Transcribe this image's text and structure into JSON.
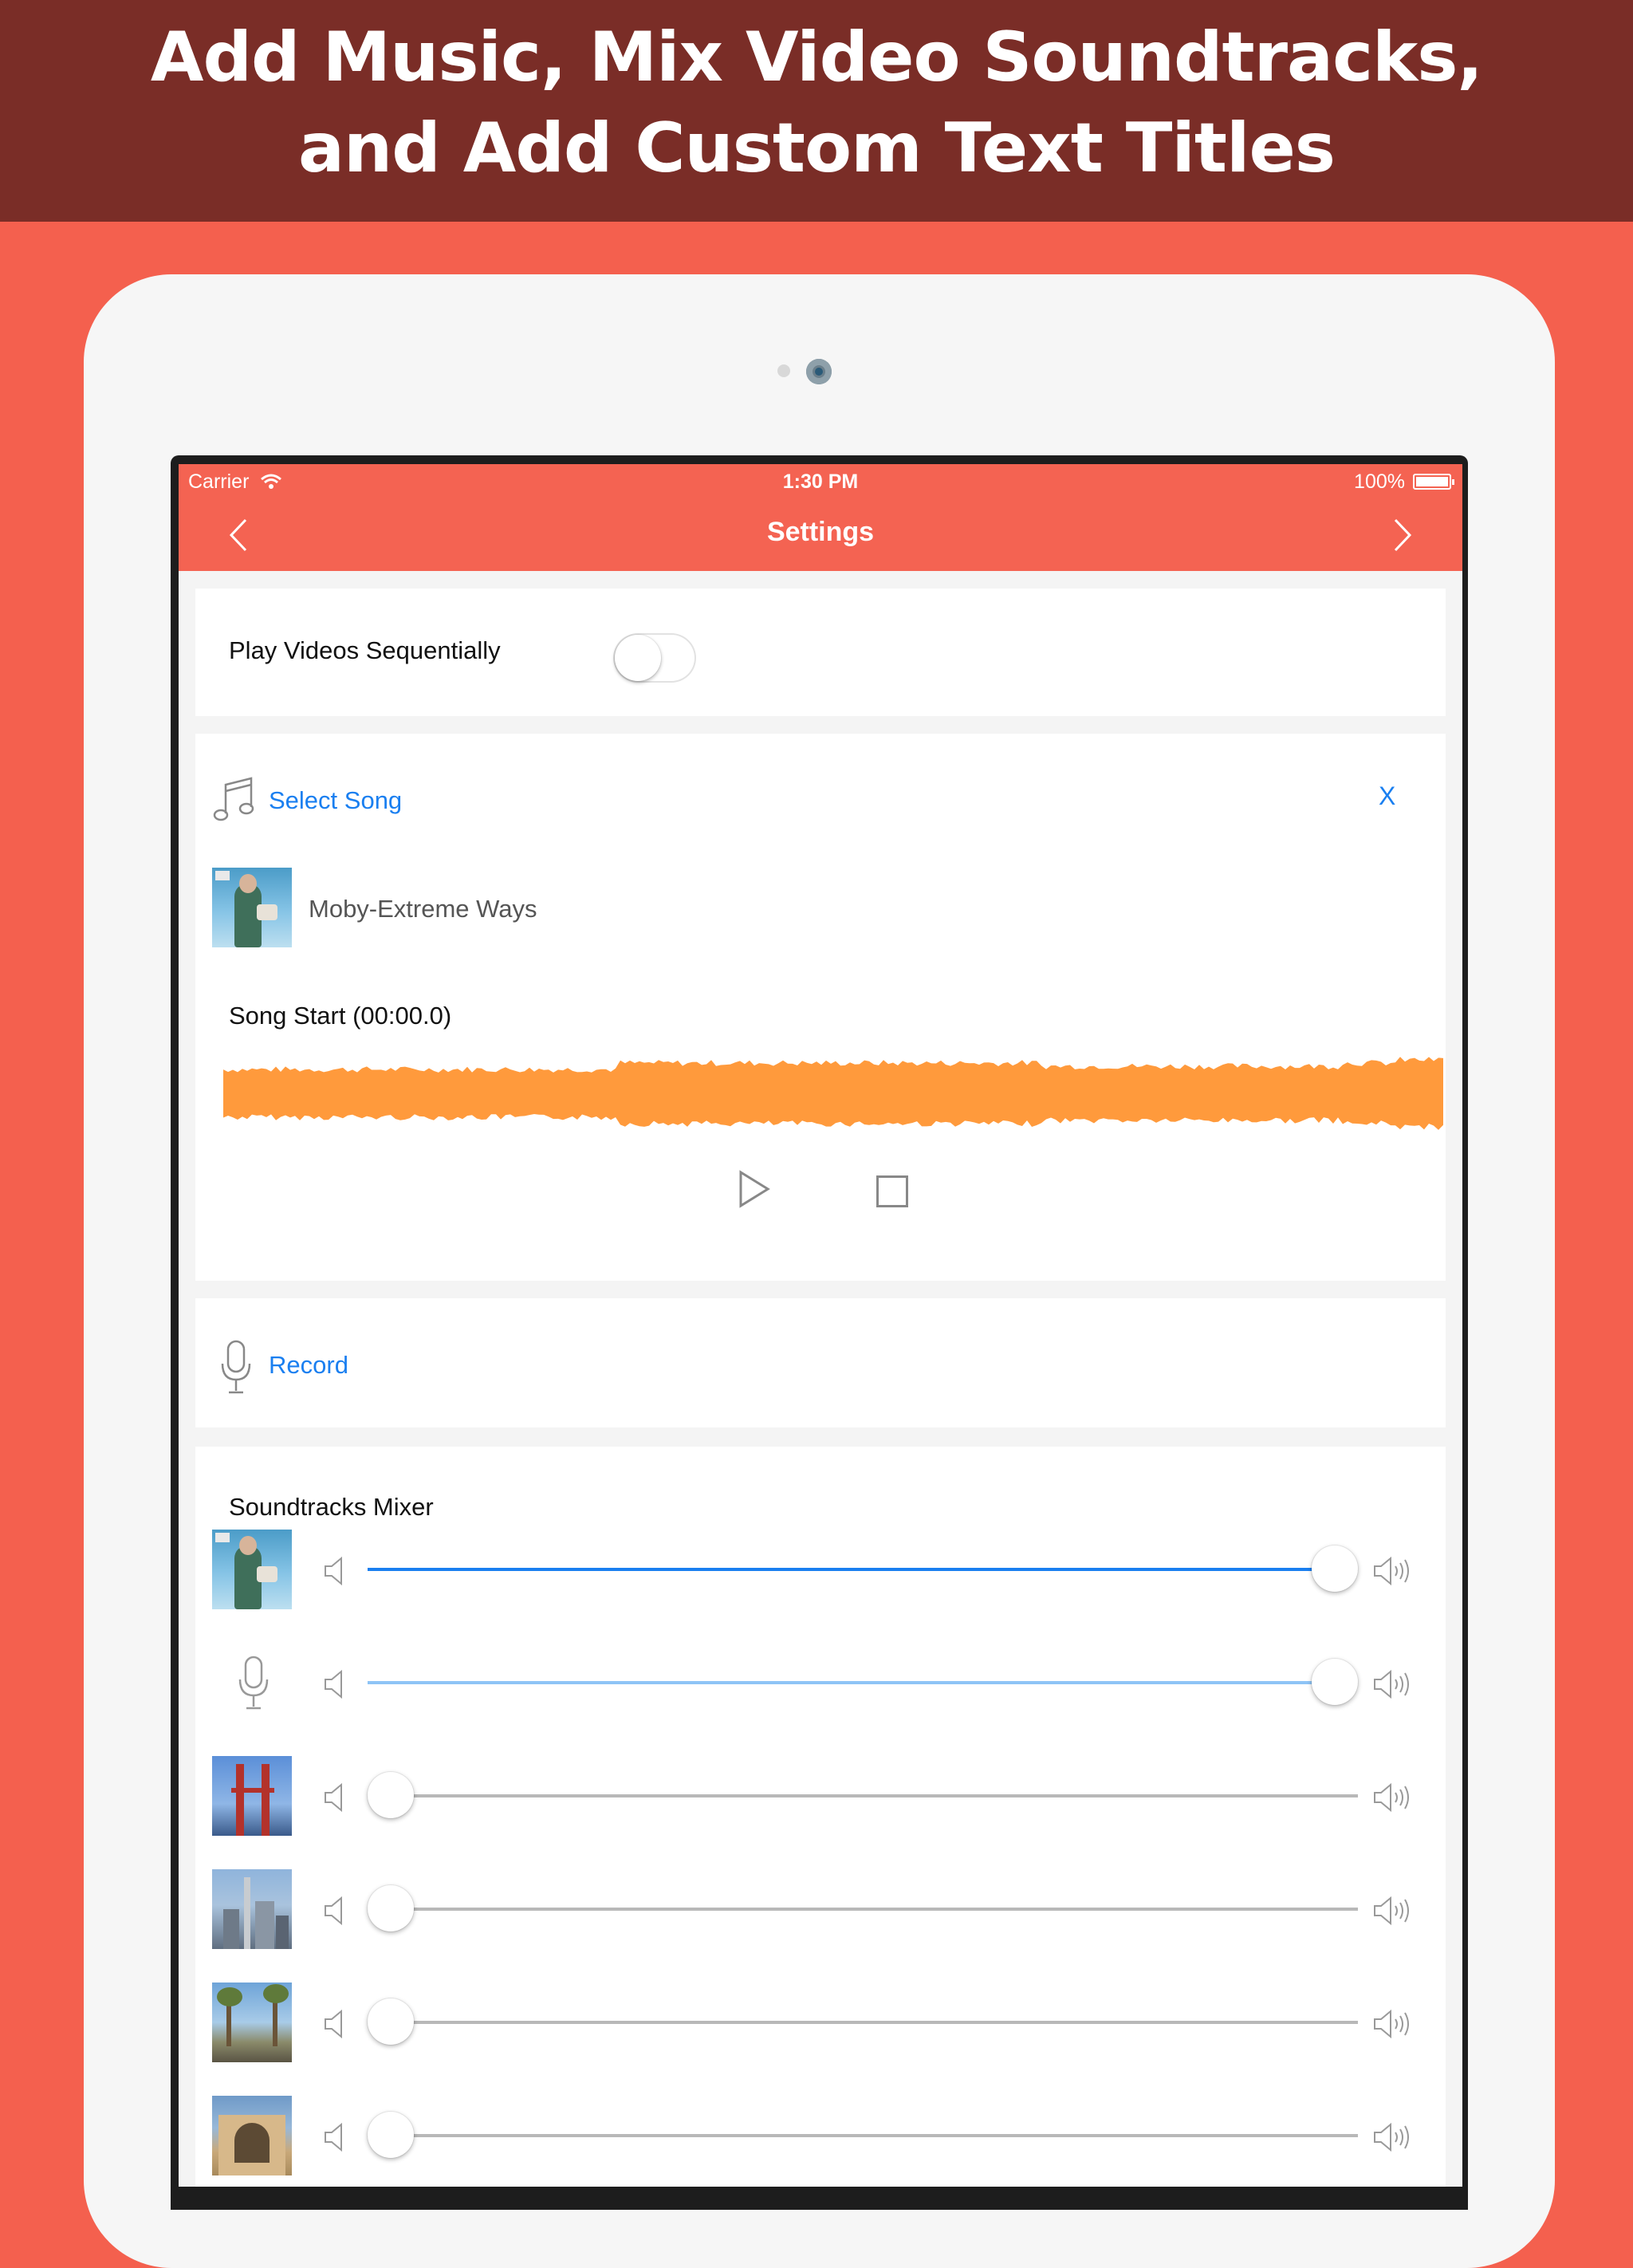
{
  "banner": {
    "line1": "Add Music, Mix Video Soundtracks,",
    "line2": "and Add Custom Text Titles"
  },
  "statusbar": {
    "carrier": "Carrier",
    "time": "1:30 PM",
    "battery": "100%"
  },
  "navbar": {
    "title": "Settings",
    "back_icon": "chevron-left-icon",
    "forward_icon": "chevron-right-icon"
  },
  "settings": {
    "play_sequential_label": "Play Videos Sequentially",
    "play_sequential_on": false,
    "select_song_label": "Select Song",
    "clear_label": "X",
    "song_title": "Moby-Extreme Ways",
    "song_start_label": "Song Start (00:00.0)",
    "record_label": "Record",
    "mixer_title": "Soundtracks Mixer"
  },
  "mixer_rows": [
    {
      "kind": "song",
      "volume": 1.0,
      "fill_color": "#1a7ff0"
    },
    {
      "kind": "recording",
      "volume": 1.0,
      "fill_color": "#8ec4f6"
    },
    {
      "kind": "video",
      "thumb": "golden-gate-bridge",
      "volume": 0.0
    },
    {
      "kind": "video",
      "thumb": "city-skyline",
      "volume": 0.0
    },
    {
      "kind": "video",
      "thumb": "palm-avenue",
      "volume": 0.0
    },
    {
      "kind": "video",
      "thumb": "campus-building",
      "volume": 0.0
    }
  ],
  "colors": {
    "banner": "#7a2d27",
    "background": "#f4604e",
    "accent": "#1a7ff0",
    "waveform": "#ff9a3c"
  }
}
